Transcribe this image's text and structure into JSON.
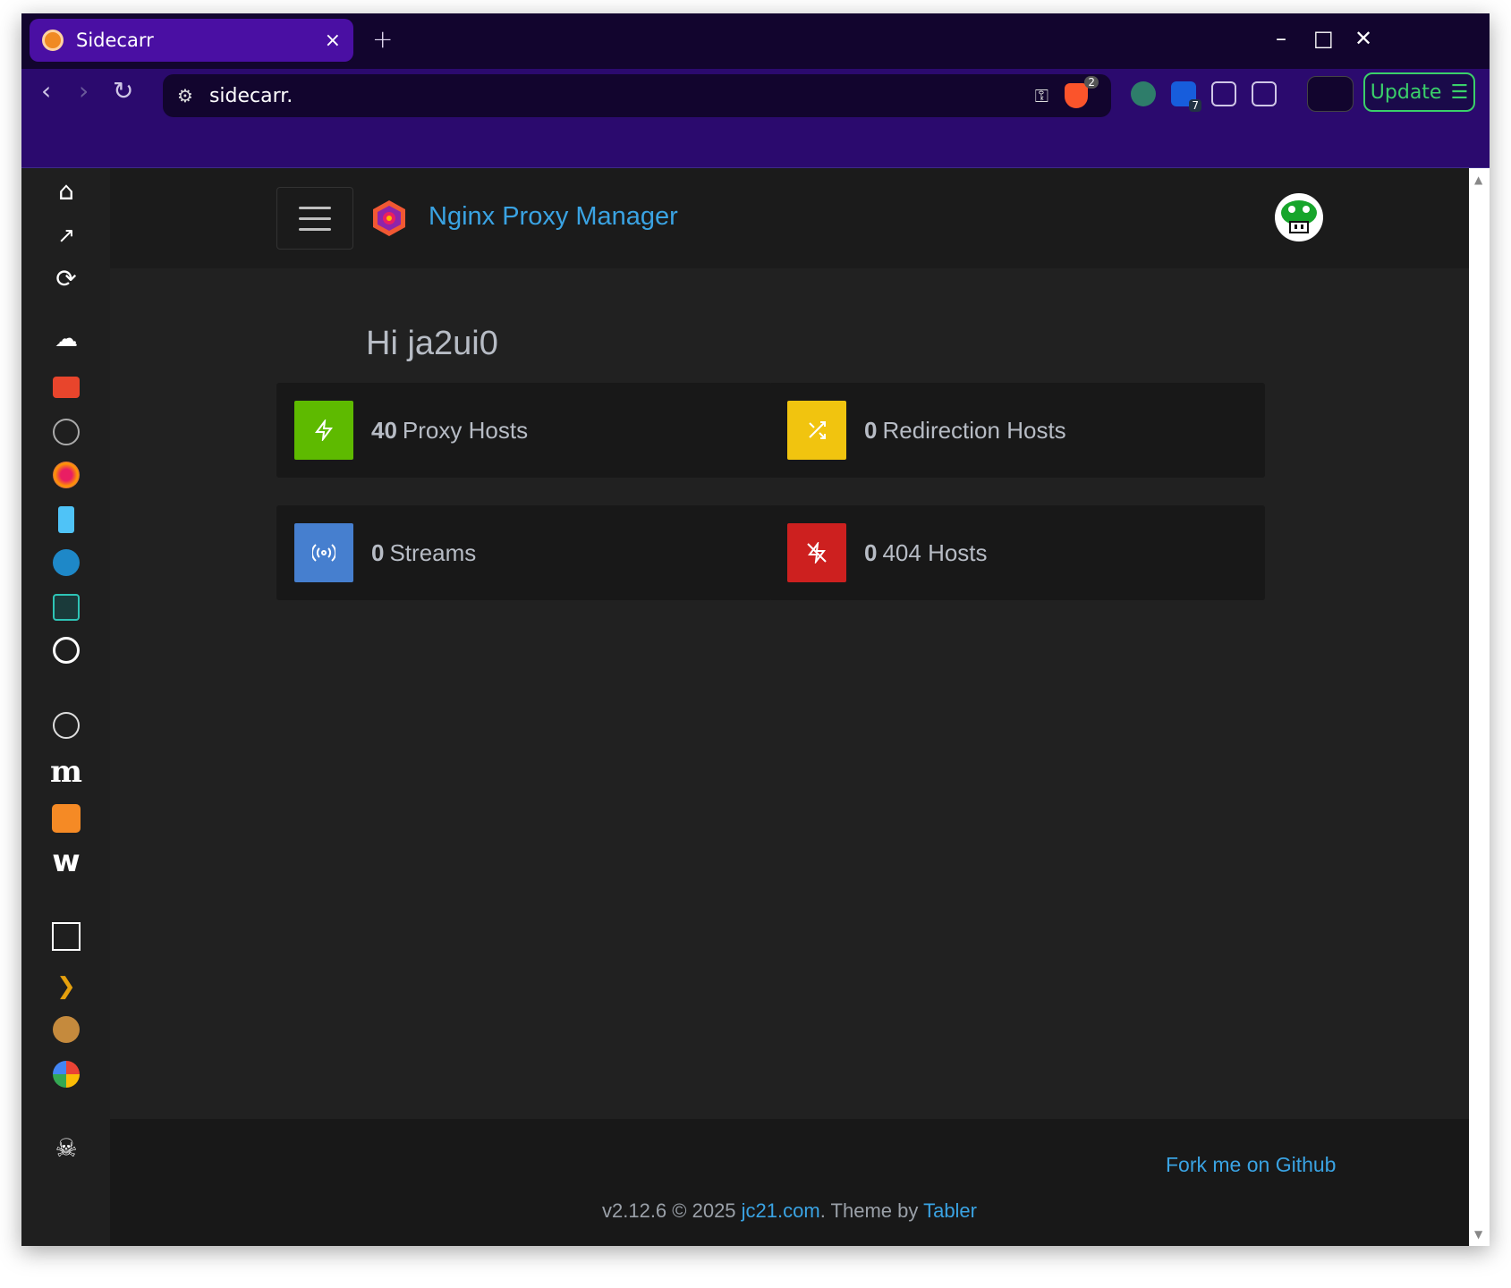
{
  "browser": {
    "tab_title": "Sidecarr",
    "tab_close": "×",
    "new_tab": "+",
    "url": "sidecarr.",
    "brave_badge": "2",
    "bitwarden_badge": "7",
    "update_label": "Update",
    "window_minimize": "–",
    "window_maximize": "□",
    "window_close": "✕"
  },
  "app": {
    "brand": "Nginx Proxy Manager",
    "greeting": "Hi ja2ui0"
  },
  "cards": [
    {
      "count": "40",
      "label": "Proxy Hosts",
      "color": "#5eba00",
      "icon": "zap-icon"
    },
    {
      "count": "0",
      "label": "Redirection Hosts",
      "color": "#f1c40f",
      "icon": "shuffle-icon"
    },
    {
      "count": "0",
      "label": "Streams",
      "color": "#467fcf",
      "icon": "radio-icon"
    },
    {
      "count": "0",
      "label": "404 Hosts",
      "color": "#cd201f",
      "icon": "zap-off-icon"
    }
  ],
  "footer": {
    "fork": "Fork me on Github",
    "version": "v2.12.6 © 2025 ",
    "jc21": "jc21.com",
    "theme_by": ". Theme by ",
    "tabler": "Tabler"
  }
}
